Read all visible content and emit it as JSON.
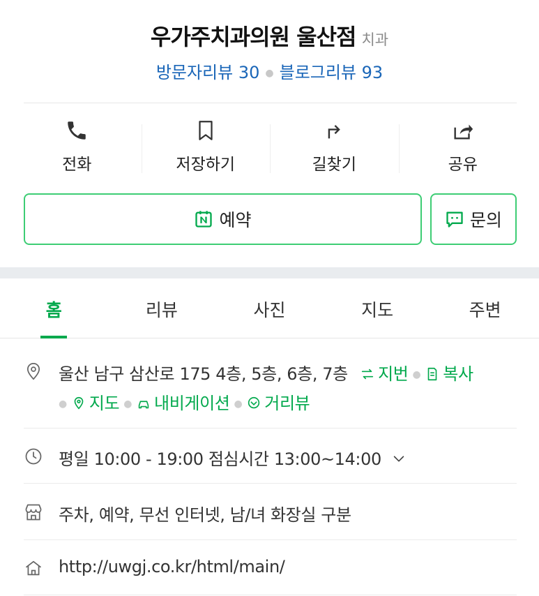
{
  "header": {
    "place_name": "우가주치과의원 울산점",
    "category": "치과",
    "visitor_reviews": "방문자리뷰 30",
    "blog_reviews": "블로그리뷰 93"
  },
  "actions": {
    "call": "전화",
    "save": "저장하기",
    "directions": "길찾기",
    "share": "공유"
  },
  "buttons": {
    "reserve": "예약",
    "inquiry": "문의"
  },
  "tabs": [
    "홈",
    "리뷰",
    "사진",
    "지도",
    "주변"
  ],
  "info": {
    "address": "울산 남구 삼산로 175 4층, 5층, 6층, 7층",
    "jibun": "지번",
    "copy": "복사",
    "map": "지도",
    "navigation": "내비게이션",
    "street_view": "거리뷰",
    "hours": "평일 10:00 - 19:00 점심시간 13:00~14:00",
    "amenities": "주차, 예약, 무선 인터넷, 남/녀 화장실 구분",
    "homepage": "http://uwgj.co.kr/html/main/"
  },
  "colors": {
    "accent_green": "#03a94d",
    "button_border": "#3dcd74",
    "review_blue": "#1a66b8"
  }
}
